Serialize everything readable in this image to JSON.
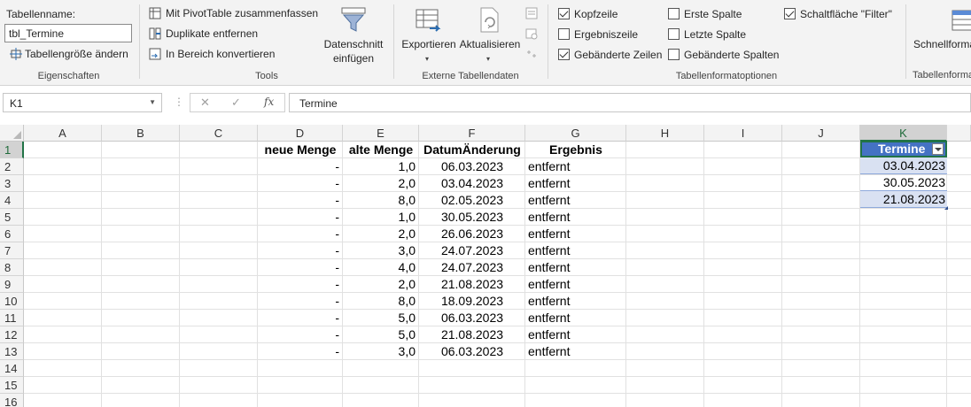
{
  "ribbon": {
    "eigenschaften": {
      "tabellenname_label": "Tabellenname:",
      "tabellenname_value": "tbl_Termine",
      "groesse_label": "Tabellengröße ändern",
      "group_label": "Eigenschaften"
    },
    "tools": {
      "pivot_label": "Mit PivotTable zusammenfassen",
      "duplikate_label": "Duplikate entfernen",
      "bereich_label": "In Bereich konvertieren",
      "datenschnitt_line1": "Datenschnitt",
      "datenschnitt_line2": "einfügen",
      "group_label": "Tools"
    },
    "extern": {
      "exportieren_label": "Exportieren",
      "aktualisieren_label": "Aktualisieren",
      "group_label": "Externe Tabellendaten"
    },
    "formatoptionen": {
      "kopfzeile_label": "Kopfzeile",
      "ergebniszeile_label": "Ergebniszeile",
      "gebaenderte_zeilen_label": "Gebänderte Zeilen",
      "erste_spalte_label": "Erste Spalte",
      "letzte_spalte_label": "Letzte Spalte",
      "gebaenderte_spalten_label": "Gebänderte Spalten",
      "filter_label": "Schaltfläche \"Filter\"",
      "group_label": "Tabellenformatoptionen",
      "checked": {
        "kopfzeile": true,
        "ergebniszeile": false,
        "gebaenderte_zeilen": true,
        "erste_spalte": false,
        "letzte_spalte": false,
        "gebaenderte_spalten": false,
        "filter": true
      }
    },
    "schnell": {
      "label": "Schnellforma",
      "group_label": "Tabellenforma"
    }
  },
  "formula_bar": {
    "name_box": "K1",
    "cancel_glyph": "✕",
    "enter_glyph": "✓",
    "fx_glyph": "fx",
    "formula": "Termine"
  },
  "grid": {
    "columns": [
      "A",
      "B",
      "C",
      "D",
      "E",
      "F",
      "G",
      "H",
      "I",
      "J",
      "K"
    ],
    "rows": [
      "1",
      "2",
      "3",
      "4",
      "5",
      "6",
      "7",
      "8",
      "9",
      "10",
      "11",
      "12",
      "13",
      "14",
      "15",
      "16"
    ],
    "selected_column": "K",
    "selected_row": "1",
    "headers": {
      "neue_menge": "neue Menge",
      "alte_menge": "alte Menge",
      "datum_aenderung": "DatumÄnderung",
      "ergebnis": "Ergebnis"
    },
    "data_rows": [
      {
        "neue": "-",
        "alte": "1,0",
        "datum": "06.03.2023",
        "ergebnis": "entfernt"
      },
      {
        "neue": "-",
        "alte": "2,0",
        "datum": "03.04.2023",
        "ergebnis": "entfernt"
      },
      {
        "neue": "-",
        "alte": "8,0",
        "datum": "02.05.2023",
        "ergebnis": "entfernt"
      },
      {
        "neue": "-",
        "alte": "1,0",
        "datum": "30.05.2023",
        "ergebnis": "entfernt"
      },
      {
        "neue": "-",
        "alte": "2,0",
        "datum": "26.06.2023",
        "ergebnis": "entfernt"
      },
      {
        "neue": "-",
        "alte": "3,0",
        "datum": "24.07.2023",
        "ergebnis": "entfernt"
      },
      {
        "neue": "-",
        "alte": "4,0",
        "datum": "24.07.2023",
        "ergebnis": "entfernt"
      },
      {
        "neue": "-",
        "alte": "2,0",
        "datum": "21.08.2023",
        "ergebnis": "entfernt"
      },
      {
        "neue": "-",
        "alte": "8,0",
        "datum": "18.09.2023",
        "ergebnis": "entfernt"
      },
      {
        "neue": "-",
        "alte": "5,0",
        "datum": "06.03.2023",
        "ergebnis": "entfernt"
      },
      {
        "neue": "-",
        "alte": "5,0",
        "datum": "21.08.2023",
        "ergebnis": "entfernt"
      },
      {
        "neue": "-",
        "alte": "3,0",
        "datum": "06.03.2023",
        "ergebnis": "entfernt"
      }
    ],
    "termine_table": {
      "header": "Termine",
      "values": [
        "03.04.2023",
        "30.05.2023",
        "21.08.2023"
      ]
    }
  },
  "colors": {
    "table_header": "#4472c4",
    "band": "#d9e1f2",
    "selection": "#217346"
  }
}
